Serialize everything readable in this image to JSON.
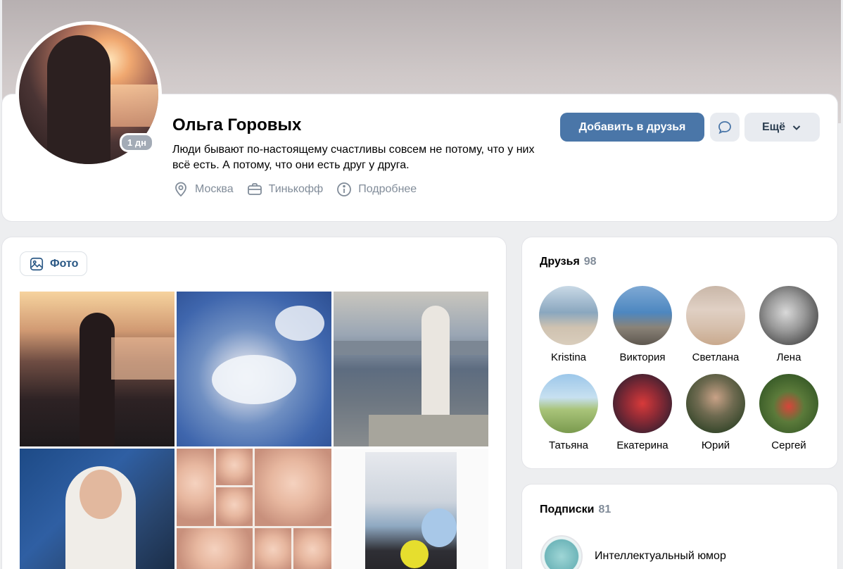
{
  "profile": {
    "name": "Ольга Горовых",
    "status": "Люди бывают по-настоящему счастливы совсем не потому, что у них всё есть. А потому, что они есть друг у друга.",
    "online_badge": "1 дн",
    "city": "Москва",
    "work": "Тинькофф",
    "more_info": "Подробнее"
  },
  "actions": {
    "add_friend": "Добавить в друзья",
    "more": "Ещё"
  },
  "photos": {
    "tab_label": "Фото"
  },
  "friends": {
    "title": "Друзья",
    "count": "98",
    "items": [
      {
        "name": "Kristina"
      },
      {
        "name": "Виктория"
      },
      {
        "name": "Светлана"
      },
      {
        "name": "Лена"
      },
      {
        "name": "Татьяна"
      },
      {
        "name": "Екатерина"
      },
      {
        "name": "Юрий"
      },
      {
        "name": "Сергей"
      }
    ]
  },
  "subscriptions": {
    "title": "Подписки",
    "count": "81",
    "items": [
      {
        "name": "Интеллектуальный юмор"
      }
    ]
  },
  "colors": {
    "accent": "#4a76a8",
    "secondary_text": "#818c99",
    "page_bg": "#edeef0"
  }
}
